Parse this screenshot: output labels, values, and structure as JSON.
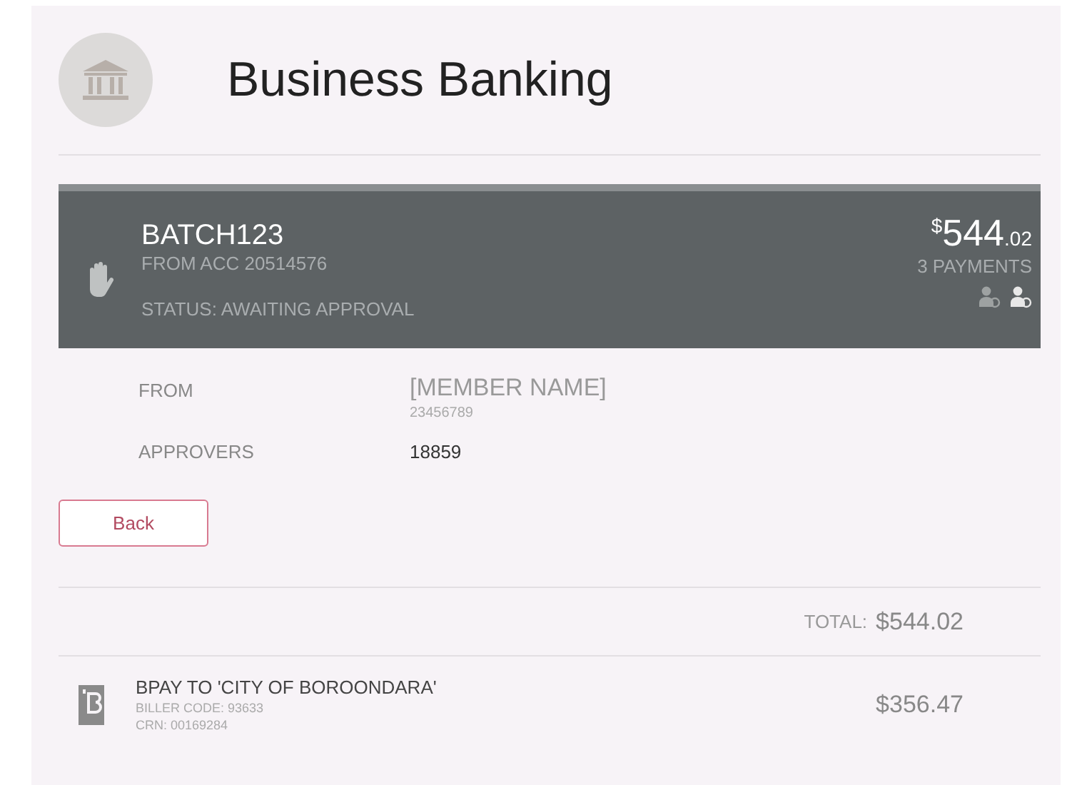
{
  "header": {
    "title": "Business Banking"
  },
  "batch": {
    "name": "BATCH123",
    "from_account": "FROM ACC 20514576",
    "status": "STATUS: AWAITING APPROVAL",
    "amount_currency": "$",
    "amount_whole": "544",
    "amount_cents": ".02",
    "payments": "3 PAYMENTS"
  },
  "details": [
    {
      "label": "FROM",
      "value": "[MEMBER NAME]",
      "sub": "23456789"
    },
    {
      "label": "APPROVERS",
      "value": "18859"
    }
  ],
  "back_button": "Back",
  "total": {
    "label": "TOTAL:",
    "amount": "$544.02"
  },
  "payments": [
    {
      "title": "BPAY TO 'CITY OF BOROONDARA'",
      "biller_code": "BILLER CODE: 93633",
      "crn": "CRN: 00169284",
      "amount": "$356.47"
    }
  ]
}
